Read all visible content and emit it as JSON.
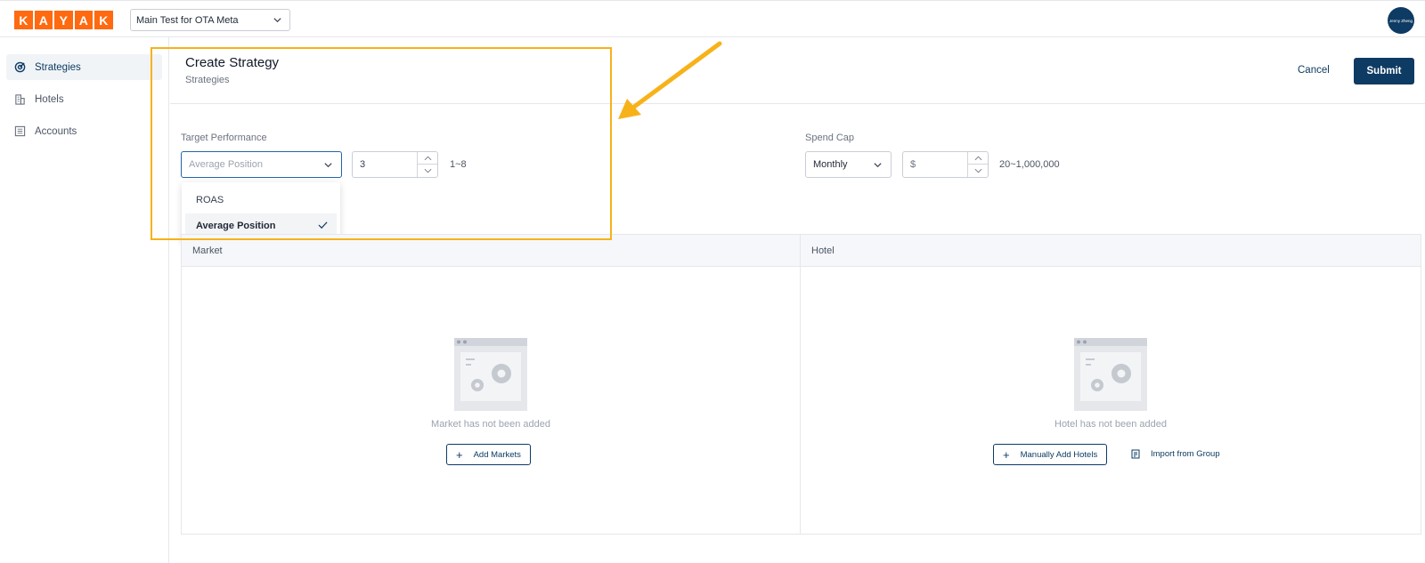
{
  "brand": {
    "letters": [
      "K",
      "A",
      "Y",
      "A",
      "K"
    ],
    "color": "#ff690f"
  },
  "account": {
    "selected": "Main Test for OTA Meta"
  },
  "user": {
    "name": "Jenny Zheng"
  },
  "sidebar": {
    "items": [
      {
        "label": "Strategies",
        "icon": "target-icon",
        "active": true
      },
      {
        "label": "Hotels",
        "icon": "building-icon",
        "active": false
      },
      {
        "label": "Accounts",
        "icon": "list-icon",
        "active": false
      }
    ]
  },
  "header": {
    "title": "Create Strategy",
    "breadcrumb": "Strategies",
    "cancel_label": "Cancel",
    "submit_label": "Submit"
  },
  "target_performance": {
    "label": "Target Performance",
    "selected_placeholder": "Average Position",
    "value": "3",
    "range": "1~8",
    "options": [
      {
        "label": "ROAS",
        "selected": false
      },
      {
        "label": "Average Position",
        "selected": true
      }
    ]
  },
  "spend_cap": {
    "label": "Spend Cap",
    "period": "Monthly",
    "amount_placeholder": "$",
    "range": "20~1,000,000"
  },
  "market_panel": {
    "header": "Market",
    "empty_text": "Market has not been added",
    "add_label": "Add Markets"
  },
  "hotel_panel": {
    "header": "Hotel",
    "empty_text": "Hotel has not been added",
    "add_label": "Manually Add Hotels",
    "import_label": "Import from Group"
  },
  "colors": {
    "primary": "#0e3b63",
    "annotation": "#f7b21a"
  }
}
